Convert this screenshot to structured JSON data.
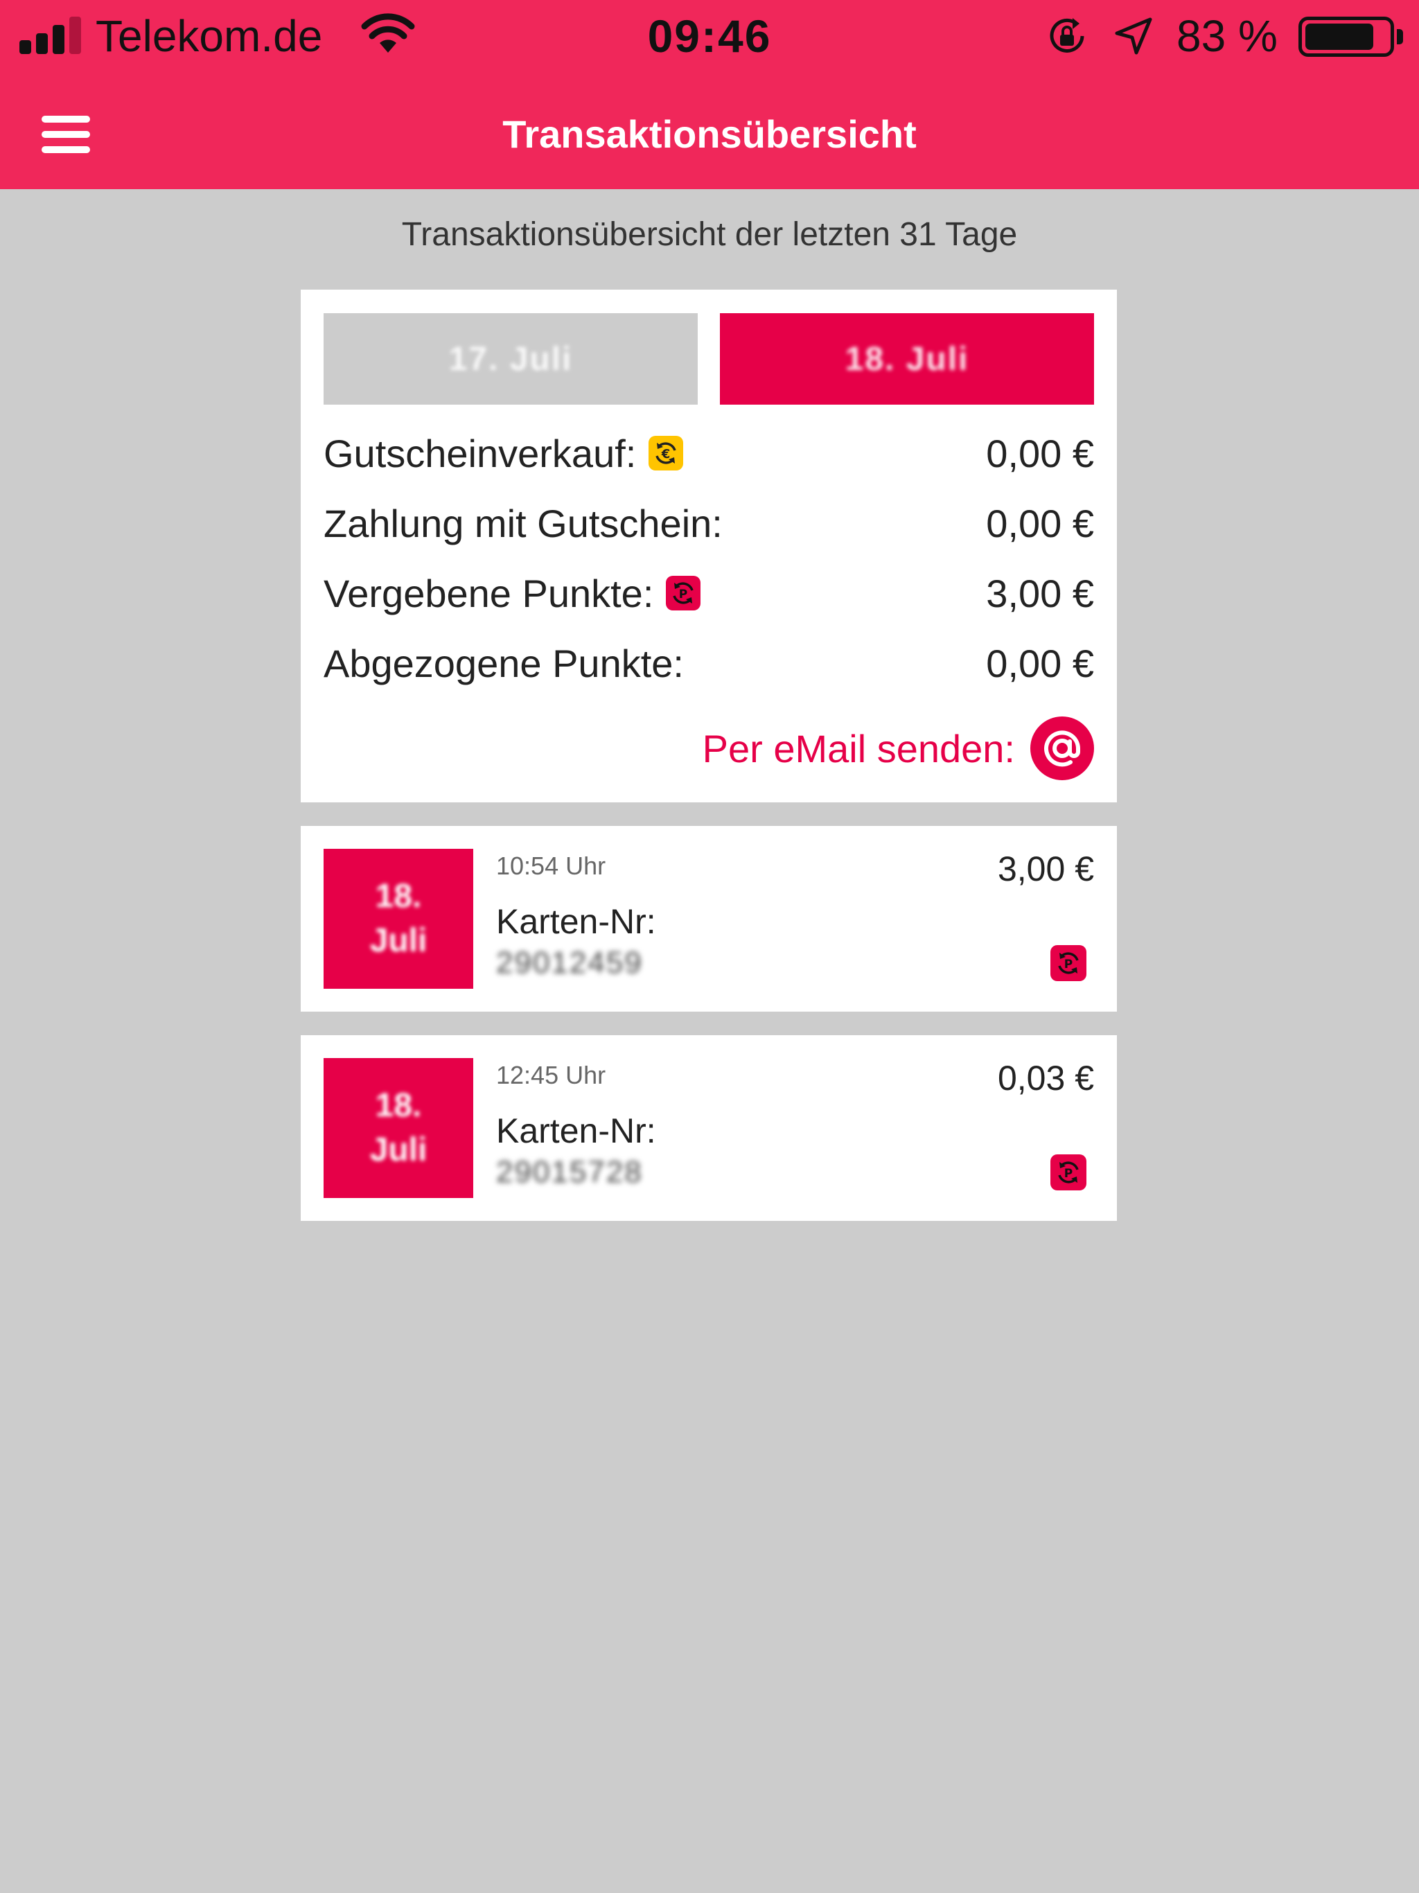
{
  "status_bar": {
    "carrier": "Telekom.de",
    "time": "09:46",
    "battery_text": "83 %",
    "battery_level": 0.83
  },
  "nav": {
    "title": "Transaktionsübersicht",
    "menu_icon": "hamburger-menu-icon"
  },
  "subtitle": "Transaktionsübersicht der letzten 31 Tage",
  "date_tabs": [
    {
      "label": "17. Juli",
      "active": false
    },
    {
      "label": "18. Juli",
      "active": true
    }
  ],
  "summary": [
    {
      "label": "Gutscheinverkauf:",
      "icon": "euro-exchange-icon",
      "value": "0,00 €"
    },
    {
      "label": "Zahlung mit Gutschein:",
      "icon": "",
      "value": "0,00 €"
    },
    {
      "label": "Vergebene Punkte:",
      "icon": "points-exchange-icon",
      "value": "3,00 €"
    },
    {
      "label": "Abgezogene Punkte:",
      "icon": "",
      "value": "0,00 €"
    }
  ],
  "email": {
    "label": "Per eMail senden:",
    "icon": "at-sign-icon"
  },
  "transactions": [
    {
      "thumb_line1": "18.",
      "thumb_line2": "Juli",
      "time": "10:54 Uhr",
      "card_label": "Karten-Nr:",
      "card_number": "29012459",
      "amount": "3,00 €",
      "icon": "points-exchange-icon"
    },
    {
      "thumb_line1": "18.",
      "thumb_line2": "Juli",
      "time": "12:45 Uhr",
      "card_label": "Karten-Nr:",
      "card_number": "29015728",
      "amount": "0,03 €",
      "icon": "points-exchange-icon"
    }
  ],
  "colors": {
    "brand": "#f0275a",
    "accent": "#e60048",
    "euro_badge": "#ffc400",
    "background": "#cccccc"
  }
}
